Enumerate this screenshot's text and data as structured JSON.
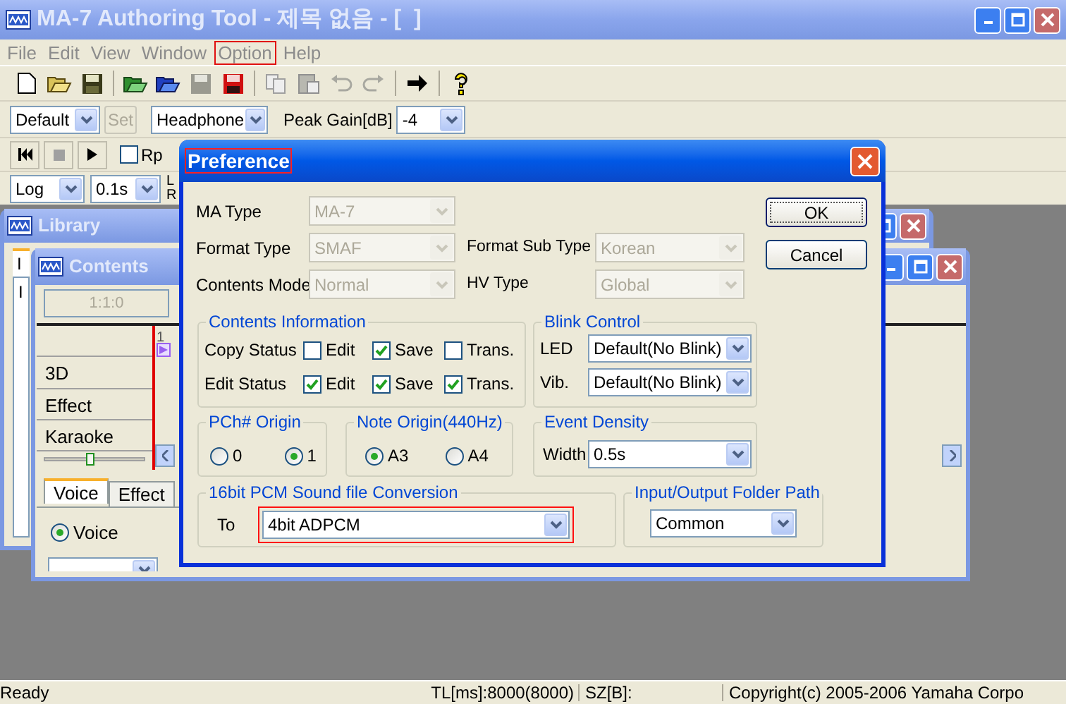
{
  "window": {
    "title": "MA-7 Authoring Tool - 제목 없음 - [  ]"
  },
  "menu": [
    {
      "label": "File",
      "highlighted": false
    },
    {
      "label": "Edit",
      "highlighted": false
    },
    {
      "label": "View",
      "highlighted": false
    },
    {
      "label": "Window",
      "highlighted": false
    },
    {
      "label": "Option",
      "highlighted": true
    },
    {
      "label": "Help",
      "highlighted": false
    }
  ],
  "output_bar": {
    "preset": "Default",
    "set_button": "Set",
    "output": "Headphone",
    "peak_gain_label": "Peak Gain[dB]",
    "peak_gain": "-4"
  },
  "transport": {
    "repeat": {
      "label": "Rp",
      "checked": false
    }
  },
  "display_bar": {
    "scale": "Log",
    "interval": "0.1s",
    "channels": [
      "L",
      "R"
    ]
  },
  "library": {
    "title": "Library",
    "tab": "I",
    "header": "I"
  },
  "contents": {
    "title": "Contents",
    "position": "1:1:0",
    "ruler_mark": "1",
    "tracks": [
      "3D",
      "Effect",
      "Karaoke"
    ],
    "tabs": [
      {
        "label": "Voice",
        "selected": true
      },
      {
        "label": "Effect",
        "selected": false
      }
    ],
    "zoom_slider": {
      "level": 0.45
    },
    "radios": [
      {
        "label": "Voice",
        "selected": true
      }
    ]
  },
  "dialog": {
    "title": "Preference",
    "title_highlighted": true,
    "fields": [
      {
        "label": "MA Type",
        "value": "MA-7",
        "disabled": true
      },
      {
        "label": "Format Type",
        "value": "SMAF",
        "disabled": true
      },
      {
        "label": "Contents Mode",
        "value": "Normal",
        "disabled": true
      }
    ],
    "side_fields": [
      {
        "label": "Format Sub Type",
        "value": "Korean",
        "disabled": true
      },
      {
        "label": "HV Type",
        "value": "Global",
        "disabled": true
      }
    ],
    "buttons": [
      {
        "label": "OK",
        "default": true
      },
      {
        "label": "Cancel",
        "default": false
      }
    ],
    "contents_information": {
      "title": "Contents Information",
      "rows": [
        {
          "label": "Copy Status",
          "options": [
            {
              "label": "Edit",
              "checked": false
            },
            {
              "label": "Save",
              "checked": true
            },
            {
              "label": "Trans.",
              "checked": false
            }
          ]
        },
        {
          "label": "Edit Status",
          "options": [
            {
              "label": "Edit",
              "checked": true
            },
            {
              "label": "Save",
              "checked": true
            },
            {
              "label": "Trans.",
              "checked": true
            }
          ]
        }
      ]
    },
    "blink_control": {
      "title": "Blink Control",
      "rows": [
        {
          "label": "LED",
          "value": "Default(No Blink)"
        },
        {
          "label": "Vib.",
          "value": "Default(No Blink)"
        }
      ]
    },
    "pch_origin": {
      "title": "PCh# Origin",
      "options": [
        {
          "label": "0",
          "selected": false
        },
        {
          "label": "1",
          "selected": true
        }
      ]
    },
    "note_origin": {
      "title": "Note Origin(440Hz)",
      "options": [
        {
          "label": "A3",
          "selected": true
        },
        {
          "label": "A4",
          "selected": false
        }
      ]
    },
    "event_density": {
      "title": "Event Density",
      "label": "Width",
      "value": "0.5s"
    },
    "conversion": {
      "title": "16bit PCM Sound file Conversion",
      "label": "To",
      "value": "4bit ADPCM",
      "highlighted": true
    },
    "folder_path": {
      "title": "Input/Output Folder Path",
      "value": "Common"
    }
  },
  "status_bar": [
    "Ready",
    "TL[ms]:8000(8000)",
    "SZ[B]:",
    "Copyright(c) 2005-2006 Yamaha Corpo"
  ]
}
